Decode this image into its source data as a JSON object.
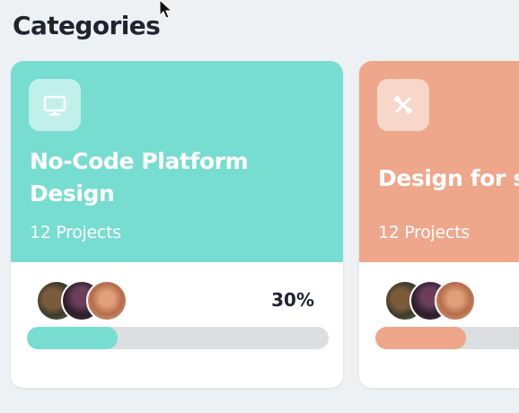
{
  "section": {
    "title": "Categories"
  },
  "cards": [
    {
      "title": "No-Code Platform Design",
      "count": "12 Projects",
      "percent_label": "30%",
      "progress": 0.3,
      "color": "#77ddd0",
      "icon": "monitor-icon"
    },
    {
      "title": "Design for so",
      "count": "12 Projects",
      "progress": 0.3,
      "color": "#eea78b",
      "icon": "crossed-tools-icon"
    }
  ]
}
